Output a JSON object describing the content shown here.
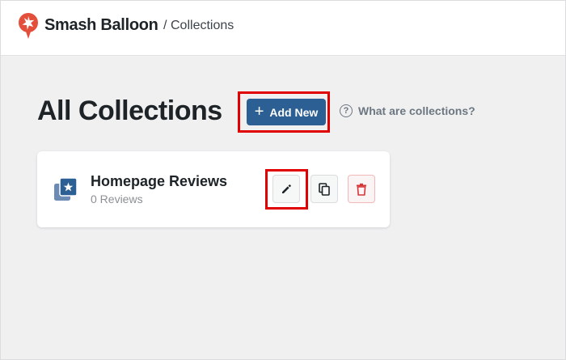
{
  "header": {
    "brand": "Smash Balloon",
    "separator": "/",
    "page": "Collections"
  },
  "main": {
    "title": "All Collections",
    "add_new_label": "Add New",
    "help_label": "What are collections?"
  },
  "collection": {
    "name": "Homepage Reviews",
    "count": "0 Reviews"
  },
  "icons": {
    "brand": "balloon-logo-icon",
    "add": "plus-icon",
    "help": "question-circle-icon",
    "collection": "collection-star-icon",
    "edit": "pencil-icon",
    "duplicate": "copy-icon",
    "delete": "trash-icon"
  },
  "colors": {
    "brand": "#e34f3b",
    "primary": "#2c5f93",
    "highlight": "#e00000",
    "danger": "#d63638"
  }
}
